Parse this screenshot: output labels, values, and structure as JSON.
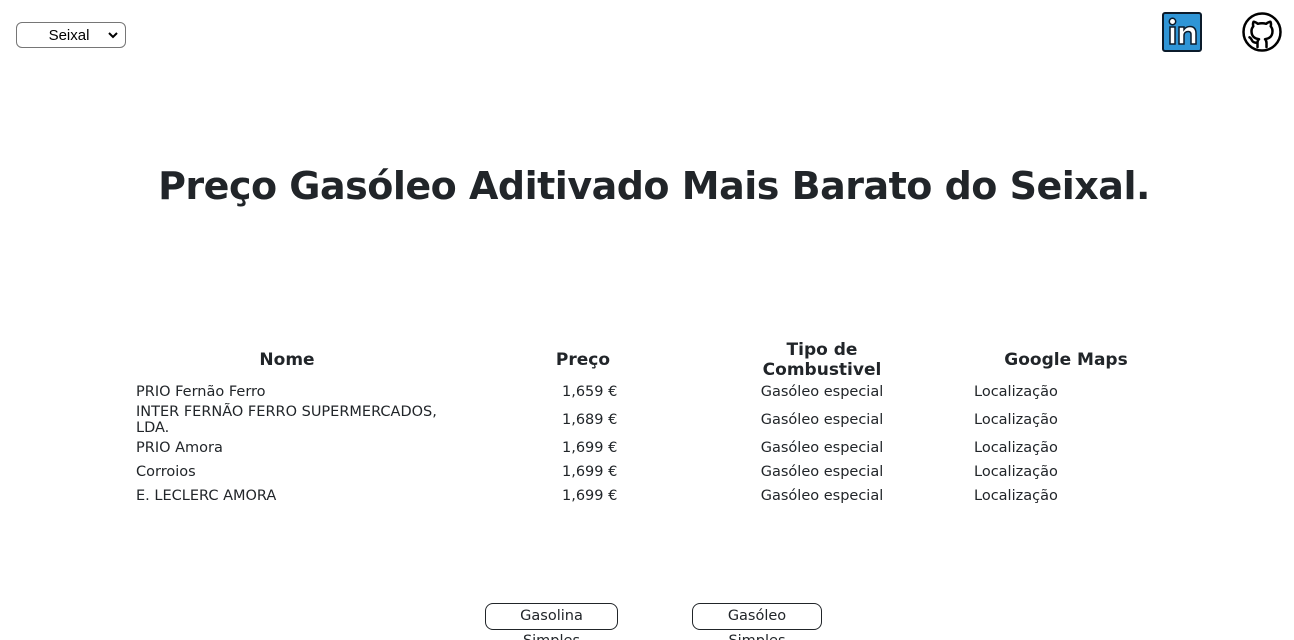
{
  "location_select": {
    "selected": "Seixal"
  },
  "social": {
    "linkedin_icon": "linkedin-icon",
    "github_icon": "github-icon",
    "linkedin_color": "#2f95d6"
  },
  "title": "Preço Gasóleo Aditivado Mais Barato do Seixal.",
  "table": {
    "headers": [
      "Nome",
      "Preço",
      "Tipo de Combustivel",
      "Google Maps"
    ],
    "rows": [
      {
        "nome": "PRIO Fernão Ferro",
        "preco": "1,659 €",
        "tipo": "Gasóleo especial",
        "maps": "Localização"
      },
      {
        "nome": "INTER FERNÃO FERRO SUPERMERCADOS, LDA.",
        "preco": "1,689 €",
        "tipo": "Gasóleo especial",
        "maps": "Localização"
      },
      {
        "nome": "PRIO Amora",
        "preco": "1,699 €",
        "tipo": "Gasóleo especial",
        "maps": "Localização"
      },
      {
        "nome": "Corroios",
        "preco": "1,699 €",
        "tipo": "Gasóleo especial",
        "maps": "Localização"
      },
      {
        "nome": "E. LECLERC AMORA",
        "preco": "1,699 €",
        "tipo": "Gasóleo especial",
        "maps": "Localização"
      }
    ]
  },
  "buttons": {
    "gasolina_simples": "Gasolina Simples",
    "gasoleo_simples": "Gasóleo Simples"
  }
}
